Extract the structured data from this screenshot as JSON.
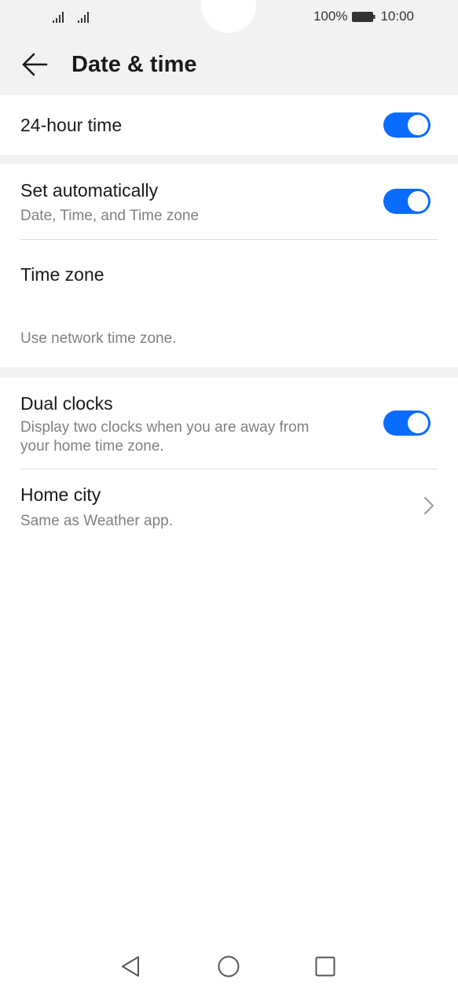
{
  "status_bar": {
    "battery_percent": "100%",
    "time": "10:00"
  },
  "header": {
    "title": "Date & time"
  },
  "settings": {
    "hour24": {
      "title": "24-hour time",
      "enabled": true
    },
    "set_auto": {
      "title": "Set automatically",
      "subtitle": "Date, Time, and Time zone",
      "enabled": true
    },
    "time_zone": {
      "title": "Time zone",
      "subtitle": "Use network time zone."
    },
    "dual_clocks": {
      "title": "Dual clocks",
      "subtitle_line1": "Display two clocks when you are away from",
      "subtitle_line2": "your home time zone.",
      "enabled": true
    },
    "home_city": {
      "title": "Home city",
      "subtitle": "Same as Weather app."
    }
  },
  "colors": {
    "accent": "#0a6cff",
    "background": "#f2f2f2"
  },
  "icons": {
    "back": "arrow-left-icon",
    "chevron": "chevron-right-icon",
    "nav_back": "triangle-back-icon",
    "nav_home": "circle-home-icon",
    "nav_recent": "square-recent-icon"
  }
}
